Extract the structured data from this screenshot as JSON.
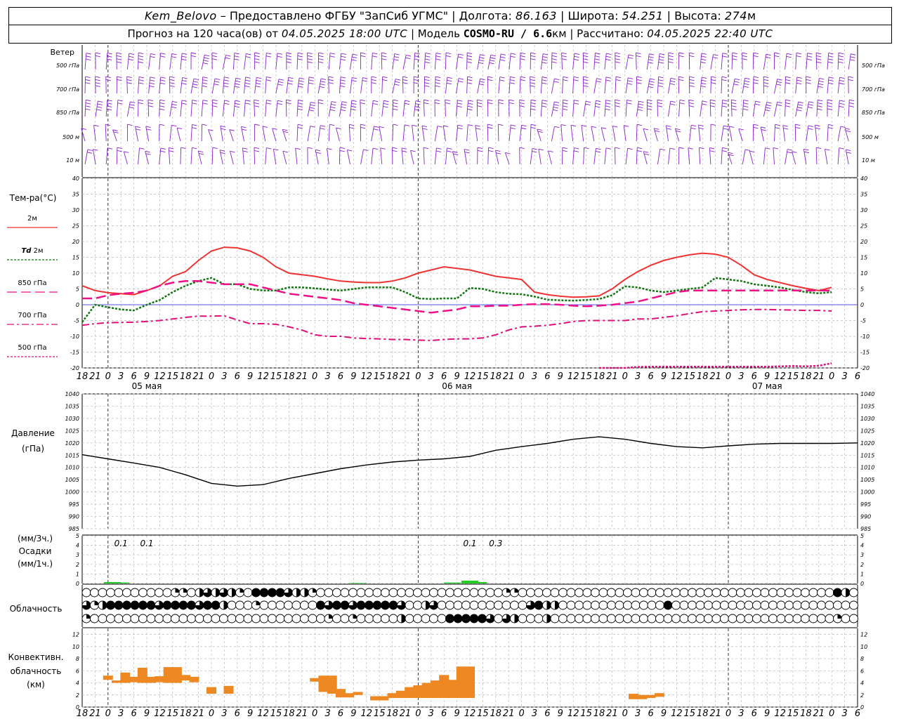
{
  "header": {
    "station": "Kem_Belovo",
    "dash": " – ",
    "provider": "Предоставлено ФГБУ \"ЗапСиб УГМС\"",
    "sep": " | ",
    "lon_label": "Долгота:",
    "lon_value": "86.163",
    "lat_label": "Широта:",
    "lat_value": "54.251",
    "alt_label": "Высота:",
    "alt_value": "274",
    "alt_unit": "м",
    "forecast_label": "Прогноз на 120 часа(ов) от",
    "forecast_start": "04.05.2025 18:00 UTC",
    "model_label": "Модель",
    "model_value": "COSMO-RU / 6.6",
    "model_unit": "км",
    "calc_label": "Рассчитано:",
    "calc_value": "04.05.2025 22:40 UTC"
  },
  "labels": {
    "wind": "Ветер",
    "levels": [
      "500 гПа",
      "700 гПа",
      "850 гПа",
      "500 м",
      "10  м"
    ],
    "temp_title": "Тем-ра(°C)",
    "legend_2m": "2м",
    "legend_td": "Td",
    "legend_td_suffix": "2м",
    "legend_850": "850 гПа",
    "legend_700": "700 гПа",
    "legend_500": "500 гПа",
    "pressure_title": "Давление",
    "pressure_unit": "(гПа)",
    "precip_unit_3h": "(мм/3ч.)",
    "precip_title": "Осадки",
    "precip_unit_1h": "(мм/1ч.)",
    "clouds_title": "Облачность",
    "conv_title_1": "Конвективн.",
    "conv_title_2": "облачность",
    "conv_unit": "(км)"
  },
  "colors": {
    "temp2m": "#ee3333",
    "td2m": "#117711",
    "t850": "#ee1188",
    "t700": "#dd1177",
    "t500": "#dd1177",
    "wind": "#8822cc",
    "precip": "#22cc22",
    "conv": "#ee8822",
    "zero_line": "#2222dd"
  },
  "chart_data": [
    {
      "type": "line",
      "name": "temperature",
      "x_hours": [
        0,
        3,
        6,
        9,
        12,
        15,
        18,
        21,
        24,
        27,
        30,
        33,
        36,
        39,
        42,
        45,
        48,
        51,
        54,
        57,
        60,
        63,
        66,
        69,
        72,
        75,
        78,
        81,
        84,
        87,
        90,
        93,
        96,
        99,
        102,
        105,
        108,
        111,
        114,
        117,
        120,
        123,
        126,
        129,
        132,
        135,
        138,
        141,
        144,
        147,
        150,
        153,
        156,
        159,
        162,
        165,
        168,
        171,
        174,
        177,
        180
      ],
      "ylim": [
        -20,
        40
      ],
      "yticks": [
        -20,
        -15,
        -10,
        -5,
        0,
        5,
        10,
        15,
        20,
        25,
        30,
        35,
        40
      ],
      "series": [
        {
          "name": "2м",
          "values": [
            6,
            4.5,
            3.8,
            3.5,
            3.2,
            4.5,
            6,
            9,
            10.5,
            14,
            17,
            18.2,
            18,
            17,
            15,
            12,
            10,
            9.5,
            9,
            8.2,
            7.5,
            7.2,
            7,
            7,
            7.5,
            8.5,
            10,
            11,
            12,
            11.5,
            11,
            10,
            9,
            8.5,
            8,
            4,
            3.2,
            2.7,
            2.4,
            2.5,
            2.8,
            5,
            8,
            10.5,
            12.5,
            14,
            15,
            15.8,
            16.3,
            16,
            15,
            12.5,
            9.5,
            8,
            7,
            6,
            5.2,
            4.5,
            5.5
          ]
        },
        {
          "name": "Td 2м",
          "values": [
            -5.5,
            0,
            -0.8,
            -1.5,
            -1.8,
            0,
            1.5,
            4,
            6,
            7.5,
            8.5,
            6.5,
            6.5,
            5,
            4.5,
            4.5,
            5.5,
            5.5,
            5.2,
            4.8,
            4.5,
            5,
            5.5,
            5.5,
            5.5,
            4,
            2,
            1.8,
            2,
            2,
            5.3,
            5,
            4,
            3.5,
            3.3,
            2.6,
            1.6,
            1.4,
            1.3,
            1.5,
            1.8,
            3,
            5.8,
            5.5,
            4.5,
            4,
            4.5,
            5,
            5.5,
            8.5,
            8,
            7.5,
            6.5,
            6,
            5.5,
            4.7,
            4,
            3.6,
            4
          ]
        },
        {
          "name": "850 гПа",
          "values": [
            2,
            2,
            3,
            3.5,
            3.8,
            4.5,
            6,
            7,
            7.5,
            7.5,
            7,
            6.5,
            6.5,
            6.5,
            5.5,
            4.5,
            3.5,
            3,
            2.5,
            2,
            1.5,
            0.5,
            0,
            -0.5,
            -1,
            -1.5,
            -2,
            -2.5,
            -2,
            -1.5,
            -0.5,
            -0.5,
            -0.3,
            -0.3,
            0,
            0.2,
            0.2,
            0,
            -0.3,
            -0.5,
            -0.3,
            0,
            0.5,
            1,
            2,
            3,
            4,
            4.5,
            4.5,
            4.5,
            4.5,
            4.5,
            4.5,
            4.5,
            4.5,
            4.5,
            4.5,
            4.5,
            4.5
          ]
        },
        {
          "name": "700 гПа",
          "values": [
            -6.5,
            -6,
            -5.7,
            -5.6,
            -5.5,
            -5.3,
            -5,
            -4.5,
            -4,
            -3.6,
            -3.6,
            -3.5,
            -4.8,
            -6,
            -6,
            -6.2,
            -7,
            -8,
            -9.5,
            -10,
            -10,
            -10.5,
            -10.7,
            -10.8,
            -11,
            -11,
            -11.2,
            -11.3,
            -11,
            -10.8,
            -10.8,
            -10.5,
            -9.5,
            -8,
            -7,
            -6.8,
            -6.5,
            -6,
            -5.3,
            -5,
            -5,
            -5,
            -5,
            -4.5,
            -4.5,
            -4,
            -3.5,
            -2.8,
            -2.2,
            -2,
            -1.8,
            -1.6,
            -1.5,
            -1.5,
            -1.6,
            -1.7,
            -1.8,
            -1.8,
            -2
          ]
        },
        {
          "name": "500 гПа",
          "values": [
            null,
            null,
            null,
            null,
            null,
            null,
            null,
            null,
            null,
            null,
            null,
            null,
            null,
            null,
            null,
            null,
            null,
            null,
            null,
            null,
            null,
            null,
            null,
            null,
            null,
            null,
            null,
            null,
            null,
            null,
            null,
            null,
            null,
            null,
            null,
            null,
            null,
            null,
            null,
            null,
            -20,
            -20,
            -20,
            -19.7,
            -19.6,
            -19.6,
            -19.6,
            -19.6,
            -19.6,
            -19.6,
            -19.6,
            -19.6,
            -19.6,
            -19.6,
            -19.5,
            -19.4,
            -19.5,
            -19.3,
            -18.5
          ]
        }
      ]
    },
    {
      "type": "line",
      "name": "pressure",
      "x_hours": [
        0,
        6,
        12,
        18,
        24,
        30,
        36,
        42,
        48,
        54,
        60,
        66,
        72,
        78,
        84,
        90,
        96,
        102,
        108,
        114,
        120,
        126,
        132,
        138,
        144,
        150,
        156,
        162,
        168,
        174,
        180
      ],
      "ylim": [
        985,
        1040
      ],
      "yticks": [
        985,
        990,
        995,
        1000,
        1005,
        1010,
        1015,
        1020,
        1025,
        1030,
        1035,
        1040
      ],
      "values": [
        1015.2,
        1013.5,
        1011.8,
        1010,
        1007,
        1003.5,
        1002.4,
        1003,
        1005.5,
        1007.5,
        1009.5,
        1011,
        1012.2,
        1013,
        1013.5,
        1014.5,
        1017,
        1018.5,
        1019.8,
        1021.5,
        1022.5,
        1021.5,
        1019.8,
        1018.5,
        1018,
        1018.8,
        1019.5,
        1019.8,
        1019.8,
        1019.8,
        1020
      ]
    },
    {
      "type": "bar",
      "name": "precipitation",
      "ylim": [
        0,
        5
      ],
      "yticks": [
        0,
        1,
        2,
        3,
        4,
        5
      ],
      "bars": [
        {
          "x": 7,
          "value": 0.15
        },
        {
          "x": 9,
          "value": 0.1
        },
        {
          "x": 64,
          "value": 0.05
        },
        {
          "x": 86,
          "value": 0.1
        },
        {
          "x": 90,
          "value": 0.3
        },
        {
          "x": 92,
          "value": 0.15
        }
      ],
      "labels_3h": [
        {
          "x": 3,
          "text": "0.1"
        },
        {
          "x": 9,
          "text": "0.1"
        },
        {
          "x": 84,
          "text": "0.1"
        },
        {
          "x": 90,
          "text": "0.3"
        }
      ]
    },
    {
      "type": "bar",
      "name": "convective_cloud",
      "ylim": [
        0,
        13
      ],
      "yticks": [
        0,
        2,
        4,
        6,
        8,
        10,
        12
      ],
      "bars": [
        {
          "x": 6,
          "base": 4.5,
          "top": 5.2
        },
        {
          "x": 8,
          "base": 4,
          "top": 4.4
        },
        {
          "x": 10,
          "base": 4,
          "top": 5.7
        },
        {
          "x": 12,
          "base": 4.1,
          "top": 5.0
        },
        {
          "x": 14,
          "base": 4,
          "top": 6.5
        },
        {
          "x": 16,
          "base": 4,
          "top": 5.0
        },
        {
          "x": 18,
          "base": 4.1,
          "top": 5.1
        },
        {
          "x": 20,
          "base": 4,
          "top": 6.6
        },
        {
          "x": 22,
          "base": 4,
          "top": 6.6
        },
        {
          "x": 24,
          "base": 4.4,
          "top": 5.3
        },
        {
          "x": 26,
          "base": 4.1,
          "top": 5.0
        },
        {
          "x": 30,
          "base": 2.2,
          "top": 3.3
        },
        {
          "x": 34,
          "base": 2.2,
          "top": 3.5
        },
        {
          "x": 54,
          "base": 4.2,
          "top": 4.8
        },
        {
          "x": 56,
          "base": 2.5,
          "top": 5.2
        },
        {
          "x": 58,
          "base": 2.2,
          "top": 5.2
        },
        {
          "x": 60,
          "base": 1.6,
          "top": 3.0
        },
        {
          "x": 62,
          "base": 1.6,
          "top": 2.3
        },
        {
          "x": 64,
          "base": 2.0,
          "top": 2.5
        },
        {
          "x": 68,
          "base": 1.1,
          "top": 1.8
        },
        {
          "x": 70,
          "base": 1.1,
          "top": 1.8
        },
        {
          "x": 72,
          "base": 1.5,
          "top": 2.3
        },
        {
          "x": 74,
          "base": 1.5,
          "top": 2.7
        },
        {
          "x": 76,
          "base": 1.5,
          "top": 3.3
        },
        {
          "x": 78,
          "base": 1.5,
          "top": 3.6
        },
        {
          "x": 80,
          "base": 1.5,
          "top": 4.0
        },
        {
          "x": 82,
          "base": 1.5,
          "top": 4.4
        },
        {
          "x": 84,
          "base": 1.5,
          "top": 5.3
        },
        {
          "x": 86,
          "base": 1.5,
          "top": 4.5
        },
        {
          "x": 88,
          "base": 1.5,
          "top": 6.7
        },
        {
          "x": 90,
          "base": 1.5,
          "top": 6.7
        },
        {
          "x": 128,
          "base": 1.3,
          "top": 2.2
        },
        {
          "x": 130,
          "base": 1.3,
          "top": 2.0
        },
        {
          "x": 132,
          "base": 1.5,
          "top": 2.0
        },
        {
          "x": 134,
          "base": 1.7,
          "top": 2.3
        }
      ]
    },
    {
      "type": "table",
      "name": "cloudiness",
      "note": "cloud cover octas per 1h step for three levels (upper, middle, lower)",
      "rows": [
        [
          0,
          0,
          0,
          0,
          0,
          0,
          0,
          0,
          0,
          0,
          0,
          2,
          2,
          0,
          4,
          6,
          4,
          6,
          4,
          2,
          0,
          8,
          8,
          8,
          8,
          6,
          4,
          4,
          2,
          0,
          0,
          0,
          0,
          0,
          0,
          0,
          0,
          0,
          0,
          0,
          0,
          0,
          0,
          0,
          0,
          0,
          0,
          0,
          0,
          0,
          0,
          0,
          2,
          2,
          0,
          0,
          0,
          0,
          0,
          0,
          0,
          0,
          0,
          0,
          0,
          0,
          0,
          0,
          0,
          0,
          0,
          0,
          0,
          0,
          0,
          0,
          0,
          0,
          0,
          0,
          0,
          0,
          0,
          0,
          0,
          0,
          0,
          0,
          0,
          0,
          0,
          0,
          0,
          8,
          4,
          0,
          0,
          0,
          0,
          0,
          0,
          0,
          0,
          0,
          0,
          0,
          0,
          0,
          0,
          4,
          0,
          2,
          0,
          6,
          8,
          8,
          8,
          8,
          8,
          8,
          6,
          0,
          0,
          0,
          0,
          2,
          0,
          0,
          0
        ],
        [
          6,
          2,
          4,
          8,
          8,
          8,
          8,
          8,
          8,
          6,
          8,
          8,
          8,
          8,
          6,
          8,
          8,
          4,
          0,
          0,
          0,
          2,
          0,
          0,
          0,
          0,
          0,
          0,
          0,
          8,
          6,
          8,
          8,
          6,
          8,
          8,
          8,
          8,
          8,
          6,
          0,
          0,
          4,
          6,
          0,
          0,
          0,
          0,
          0,
          0,
          0,
          0,
          0,
          0,
          0,
          6,
          8,
          4,
          4,
          0,
          0,
          0,
          0,
          0,
          0,
          0,
          0,
          0,
          0,
          0,
          0,
          0,
          8,
          0,
          0,
          0,
          0,
          0,
          0,
          0,
          0,
          0,
          0,
          0,
          0,
          0,
          0,
          0,
          0,
          0,
          0,
          0,
          0,
          0,
          0,
          0,
          0,
          0,
          0,
          0,
          0,
          0,
          0,
          0,
          0,
          0,
          8,
          8,
          8,
          8,
          6,
          8,
          0,
          0,
          0,
          0,
          0,
          2,
          0,
          2,
          4,
          2
        ],
        [
          2,
          0,
          0,
          0,
          0,
          0,
          0,
          0,
          0,
          0,
          0,
          0,
          0,
          0,
          0,
          0,
          0,
          0,
          0,
          0,
          0,
          0,
          0,
          0,
          0,
          0,
          0,
          0,
          0,
          0,
          2,
          0,
          0,
          2,
          0,
          0,
          0,
          0,
          0,
          4,
          0,
          0,
          0,
          0,
          0,
          8,
          8,
          8,
          8,
          8,
          6,
          0,
          6,
          4,
          0,
          0,
          0,
          4,
          0,
          0,
          0,
          0,
          0,
          0,
          0,
          0,
          0,
          0,
          0,
          0,
          0,
          0,
          0,
          0,
          0,
          0,
          0,
          0,
          0,
          0,
          0,
          0,
          0,
          0,
          0,
          0,
          0,
          0,
          0,
          0,
          0,
          0,
          0,
          2,
          0,
          0,
          0,
          0,
          0,
          0,
          0,
          0,
          0,
          0,
          0,
          0,
          0,
          0,
          0,
          0,
          0,
          0,
          0,
          0,
          0,
          0,
          0,
          0,
          0
        ]
      ]
    },
    {
      "type": "wind_barbs",
      "name": "wind",
      "levels": [
        "500 гПа",
        "700 гПа",
        "850 гПа",
        "500 м",
        "10  м"
      ]
    }
  ],
  "axis": {
    "hour_ticks": [
      "18",
      "21",
      "0",
      "3",
      "6",
      "9",
      "12",
      "15",
      "18",
      "21",
      "0",
      "3",
      "6",
      "9",
      "12",
      "15",
      "18",
      "21",
      "0",
      "3",
      "6",
      "9",
      "12",
      "15",
      "18",
      "21",
      "0"
    ],
    "dates": [
      "05 мая",
      "06 мая",
      "07 мая"
    ]
  }
}
